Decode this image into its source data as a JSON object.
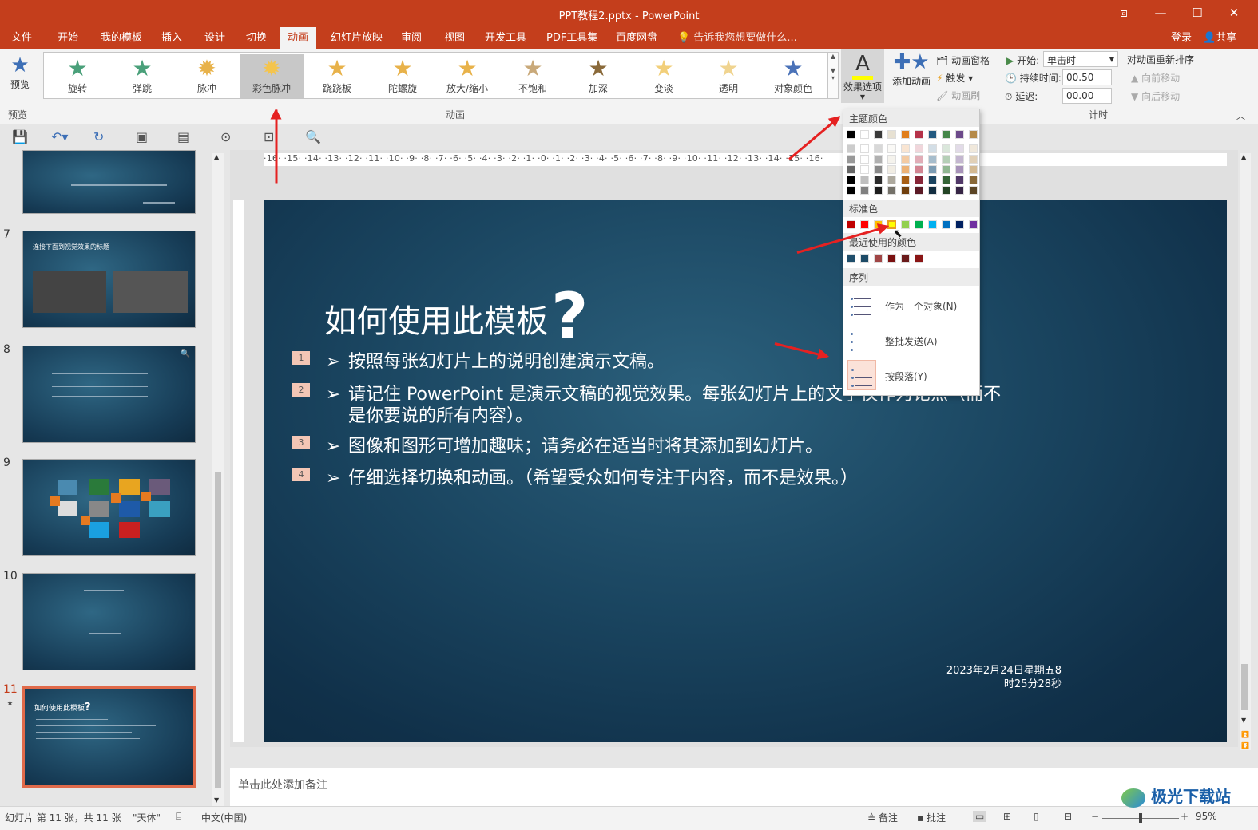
{
  "window": {
    "title": "PPT教程2.pptx - PowerPoint"
  },
  "tabs": [
    "文件",
    "开始",
    "我的模板",
    "插入",
    "设计",
    "切换",
    "动画",
    "幻灯片放映",
    "审阅",
    "视图",
    "开发工具",
    "PDF工具集",
    "百度网盘"
  ],
  "active_tab": "动画",
  "tell_me": "告诉我您想要做什么...",
  "account": {
    "login": "登录",
    "share": "共享"
  },
  "ribbon": {
    "preview": {
      "label": "预览",
      "group": "预览"
    },
    "animations": [
      "旋转",
      "弹跳",
      "脉冲",
      "彩色脉冲",
      "跷跷板",
      "陀螺旋",
      "放大/缩小",
      "不饱和",
      "加深",
      "变淡",
      "透明",
      "对象颜色"
    ],
    "selected_animation": "彩色脉冲",
    "animation_group": "动画",
    "effect_options": "效果选项",
    "add_animation": "添加动画",
    "animation_pane": "动画窗格",
    "trigger": "触发",
    "animation_painter": "动画刷",
    "timing": {
      "start_label": "开始:",
      "start_value": "单击时",
      "duration_label": "持续时间:",
      "duration_value": "00.50",
      "delay_label": "延迟:",
      "delay_value": "00.00",
      "group": "计时",
      "reorder": "对动画重新排序",
      "move_earlier": "向前移动",
      "move_later": "向后移动"
    }
  },
  "ruler": {
    "h_labels": "·16· ·15· ·14· ·13· ·12· ·11· ·10· ·9· ·8· ·7· ·6· ·5· ·4· ·3· ·2· ·1· ·0· ·1· ·2· ·3· ·4· ·5· ·6· ·7· ·8· ·9· ·10· ·11· ·12· ·13· ·14· ·15· ·16·"
  },
  "thumbnails": [
    {
      "num": "7",
      "title": "连接下面到视觉效果的标题"
    },
    {
      "num": "8"
    },
    {
      "num": "9"
    },
    {
      "num": "10"
    },
    {
      "num": "11",
      "title": "如何使用此模板"
    }
  ],
  "slide": {
    "title": "如何使用此模板",
    "title_mark": "?",
    "bullets": [
      {
        "seq": "1",
        "text": "按照每张幻灯片上的说明创建演示文稿。"
      },
      {
        "seq": "2",
        "text": "请记住 PowerPoint 是演示文稿的视觉效果。每张幻灯片上的文字仅作为论点（而不是你要说的所有内容）。"
      },
      {
        "seq": "3",
        "text": "图像和图形可增加趣味；请务必在适当时将其添加到幻灯片。"
      },
      {
        "seq": "4",
        "text": "仔细选择切换和动画。（希望受众如何专注于内容，而不是效果。）"
      }
    ],
    "date": "2023年2月24日星期五8",
    "time": "时25分28秒"
  },
  "dropdown": {
    "theme_colors_label": "主题颜色",
    "standard_colors_label": "标准色",
    "recent_colors_label": "最近使用的颜色",
    "sequence_label": "序列",
    "options": [
      "作为一个对象(N)",
      "整批发送(A)",
      "按段落(Y)"
    ],
    "theme_top": [
      "#000000",
      "#ffffff",
      "#3a3a3a",
      "#e7e1d2",
      "#e07e1c",
      "#b5334a",
      "#245a80",
      "#46874a",
      "#6c4a8a",
      "#b58a4a"
    ],
    "standard": [
      "#c00000",
      "#ff0000",
      "#ffc000",
      "#ffff00",
      "#92d050",
      "#00b050",
      "#00b0f0",
      "#0070c0",
      "#002060",
      "#7030a0"
    ],
    "recent": [
      "#1f4e6b",
      "#1c4a66",
      "#a04545",
      "#7a1010",
      "#6a1a1a",
      "#8a1515"
    ]
  },
  "notes_placeholder": "单击此处添加备注",
  "status": {
    "slide_info": "幻灯片 第 11 张，共 11 张",
    "theme": "\"天体\"",
    "language": "中文(中国)",
    "notes": "备注",
    "comments": "批注",
    "zoom": "95%"
  },
  "watermark": "极光下载站"
}
